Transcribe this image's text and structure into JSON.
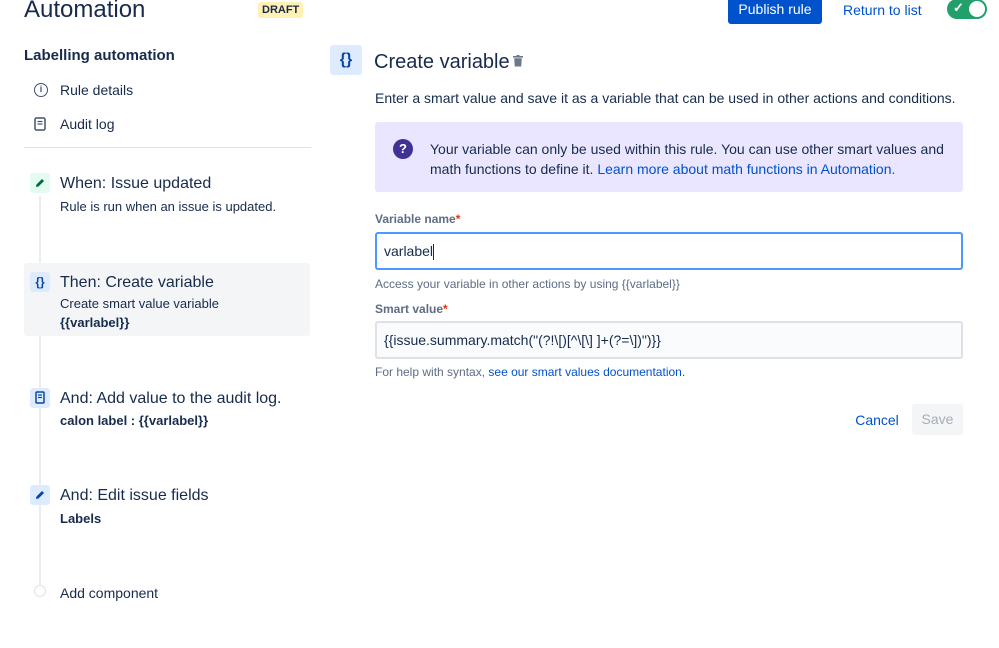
{
  "header": {
    "title": "Automation",
    "draft_badge": "DRAFT",
    "publish_label": "Publish rule",
    "return_label": "Return to list",
    "toggle_state": "on"
  },
  "sidebar": {
    "heading": "Labelling automation",
    "links": [
      {
        "label": "Rule details",
        "icon": "info-icon"
      },
      {
        "label": "Audit log",
        "icon": "document-icon"
      }
    ],
    "steps": [
      {
        "title": "When: Issue updated",
        "subtitle": "Rule is run when an issue is updated.",
        "icon": "pencil-icon"
      },
      {
        "title": "Then: Create variable",
        "subtitle": "Create smart value variable",
        "detail": "{{varlabel}}",
        "icon": "braces-icon"
      },
      {
        "title": "And: Add value to the audit log.",
        "detail": "calon label : {{varlabel}}",
        "icon": "document-icon"
      },
      {
        "title": "And: Edit issue fields",
        "detail": "Labels",
        "icon": "pencil-icon"
      }
    ],
    "add_component": "Add component"
  },
  "main": {
    "badge": "{}",
    "title": "Create variable",
    "description": "Enter a smart value and save it as a variable that can be used in other actions and conditions.",
    "info_text": "Your variable can only be used within this rule. You can use other smart values and math functions to define it.",
    "info_link": "Learn more about math functions in Automation.",
    "variable_name_label": "Variable name",
    "variable_name_value": "varlabel",
    "variable_helper": "Access your variable in other actions by using {{varlabel}}",
    "smart_value_label": "Smart value",
    "smart_value_value": "{{issue.summary.match(\"(?!\\[)[^\\[\\] ]+(?=\\])\")}}",
    "syntax_help": "For help with syntax,",
    "syntax_link": "see our smart values documentation.",
    "required_mark": "*",
    "cancel_label": "Cancel",
    "save_label": "Save"
  },
  "colors": {
    "primary": "#0052cc",
    "toggle_on": "#22a06b",
    "info_panel": "#eae6ff",
    "badge_bg": "#deebff",
    "draft_bg": "#fff0b3"
  }
}
